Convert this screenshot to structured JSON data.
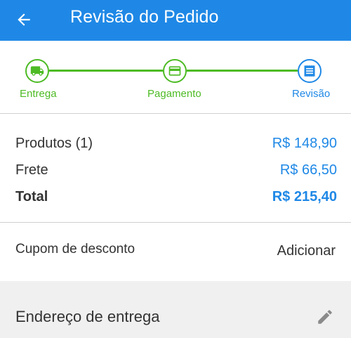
{
  "header": {
    "title": "Revisão do Pedido",
    "back_icon": "arrow-left-icon",
    "color": "#1f88e6"
  },
  "stepper": {
    "steps": [
      {
        "label": "Entrega",
        "icon": "truck-icon",
        "state": "done"
      },
      {
        "label": "Pagamento",
        "icon": "credit-card-icon",
        "state": "done"
      },
      {
        "label": "Revisão",
        "icon": "receipt-icon",
        "state": "current"
      }
    ],
    "done_color": "#4dbb24",
    "current_color": "#1f88e6"
  },
  "summary": {
    "products_label": "Produtos (1)",
    "products_value": "R$ 148,90",
    "shipping_label": "Frete",
    "shipping_value": "R$ 66,50",
    "total_label": "Total",
    "total_value": "R$ 215,40"
  },
  "coupon": {
    "label": "Cupom de desconto",
    "action": "Adicionar"
  },
  "address": {
    "title": "Endereço de entrega",
    "edit_icon": "pencil-icon"
  }
}
